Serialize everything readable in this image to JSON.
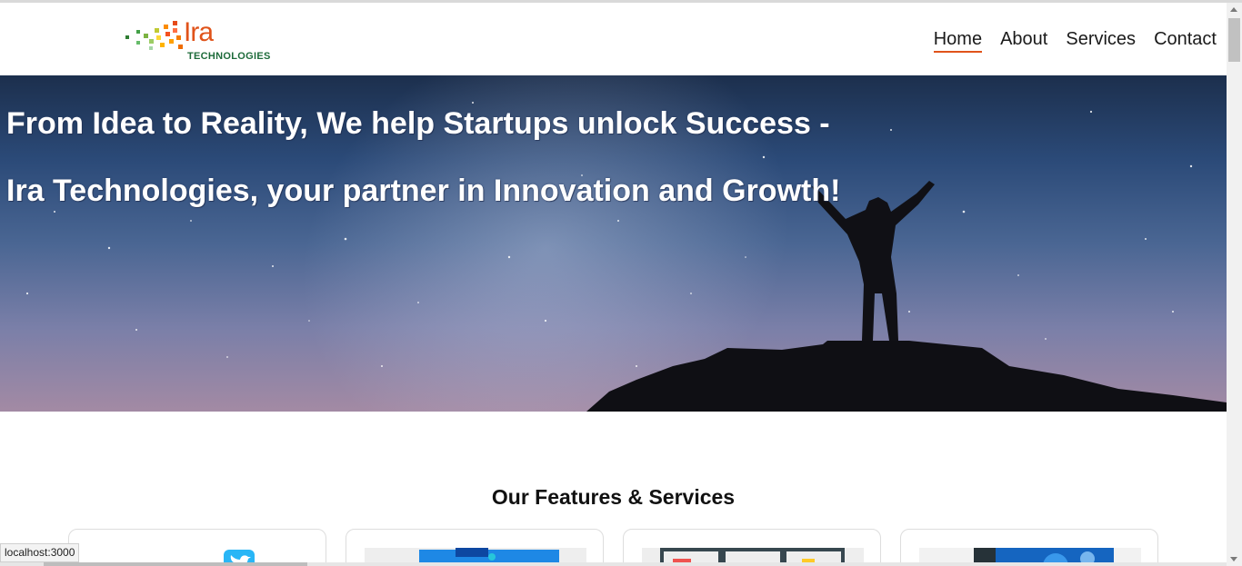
{
  "header": {
    "logo": {
      "brand": "Ira",
      "sub": "TECHNOLOGIES"
    },
    "nav": [
      {
        "label": "Home",
        "active": true
      },
      {
        "label": "About",
        "active": false
      },
      {
        "label": "Services",
        "active": false
      },
      {
        "label": "Contact",
        "active": false
      }
    ]
  },
  "hero": {
    "line1": "From Idea to Reality, We help Startups unlock Success -",
    "line2": "Ira Technologies, your partner in Innovation and Growth!"
  },
  "features": {
    "title": "Our Features & Services"
  },
  "status_bar": {
    "url": "localhost:3000"
  },
  "colors": {
    "accent": "#e0531a",
    "brand_green": "#1d6b3a"
  }
}
